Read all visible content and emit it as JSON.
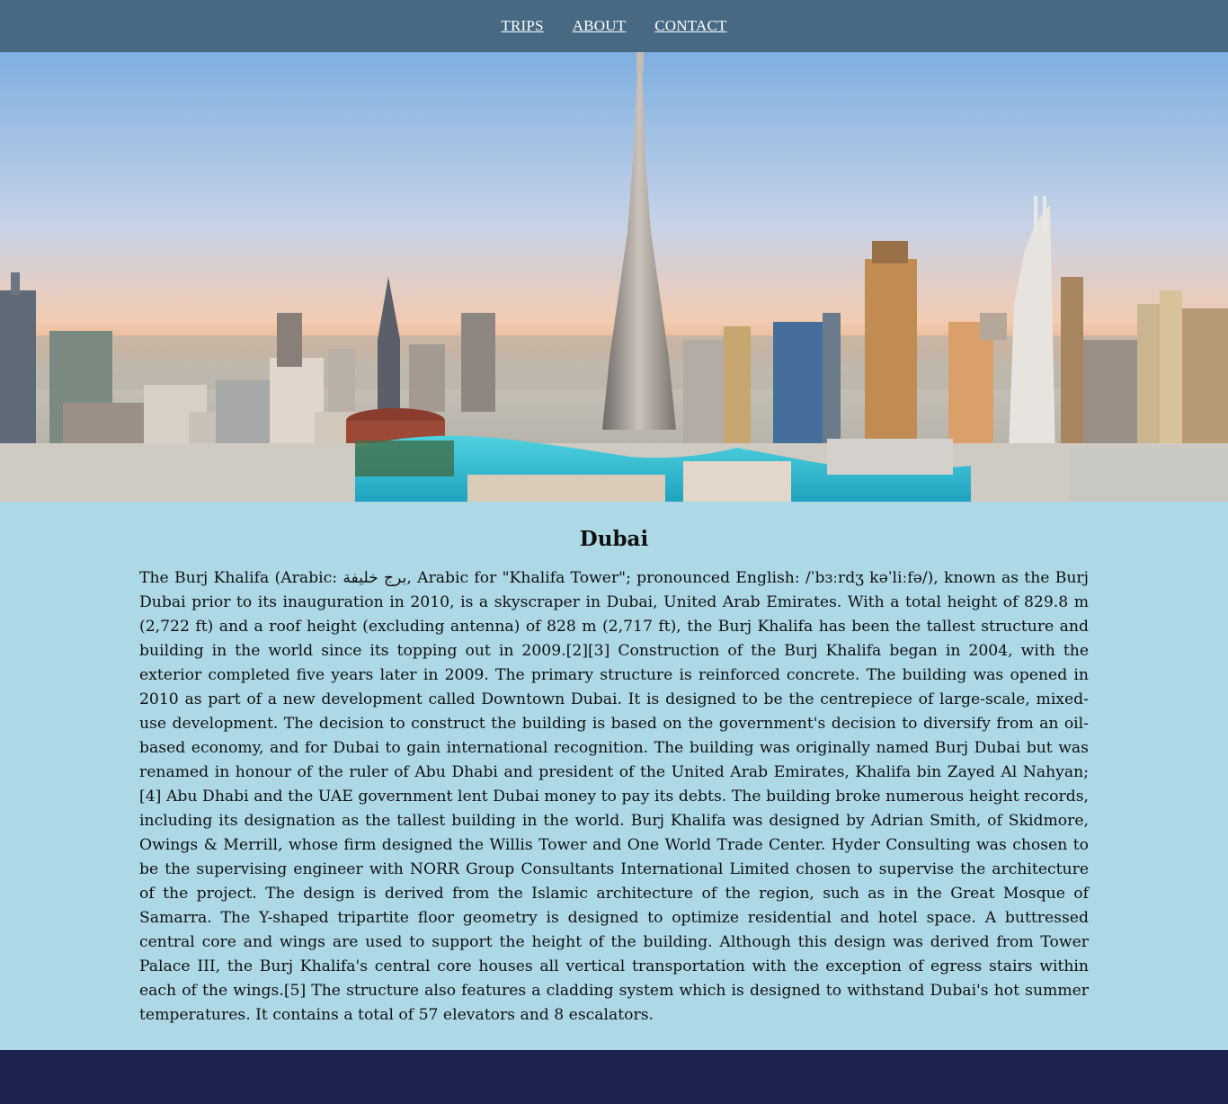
{
  "nav": {
    "items": [
      {
        "label": "TRIPS"
      },
      {
        "label": "ABOUT"
      },
      {
        "label": "CONTACT"
      }
    ]
  },
  "hero": {
    "image_subject": "Dubai skyline with Burj Khalifa at sunset"
  },
  "article": {
    "title": "Dubai",
    "body": "The Burj Khalifa (Arabic: برج خليفة, Arabic for \"Khalifa Tower\"; pronounced English: /ˈbɜːrdʒ kəˈliːfə/), known as the Burj Dubai prior to its inauguration in 2010, is a skyscraper in Dubai, United Arab Emirates. With a total height of 829.8 m (2,722 ft) and a roof height (excluding antenna) of 828 m (2,717 ft), the Burj Khalifa has been the tallest structure and building in the world since its topping out in 2009.[2][3] Construction of the Burj Khalifa began in 2004, with the exterior completed five years later in 2009. The primary structure is reinforced concrete. The building was opened in 2010 as part of a new development called Downtown Dubai. It is designed to be the centrepiece of large-scale, mixed-use development. The decision to construct the building is based on the government's decision to diversify from an oil-based economy, and for Dubai to gain international recognition. The building was originally named Burj Dubai but was renamed in honour of the ruler of Abu Dhabi and president of the United Arab Emirates, Khalifa bin Zayed Al Nahyan;[4] Abu Dhabi and the UAE government lent Dubai money to pay its debts. The building broke numerous height records, including its designation as the tallest building in the world. Burj Khalifa was designed by Adrian Smith, of Skidmore, Owings & Merrill, whose firm designed the Willis Tower and One World Trade Center. Hyder Consulting was chosen to be the supervising engineer with NORR Group Consultants International Limited chosen to supervise the architecture of the project. The design is derived from the Islamic architecture of the region, such as in the Great Mosque of Samarra. The Y-shaped tripartite floor geometry is designed to optimize residential and hotel space. A buttressed central core and wings are used to support the height of the building. Although this design was derived from Tower Palace III, the Burj Khalifa's central core houses all vertical transportation with the exception of egress stairs within each of the wings.[5] The structure also features a cladding system which is designed to withstand Dubai's hot summer temperatures. It contains a total of 57 elevators and 8 escalators."
  },
  "colors": {
    "nav_bg": "#476983",
    "content_bg": "#add8e6",
    "footer_bg": "#1c2350",
    "nav_text": "#ffffff"
  }
}
